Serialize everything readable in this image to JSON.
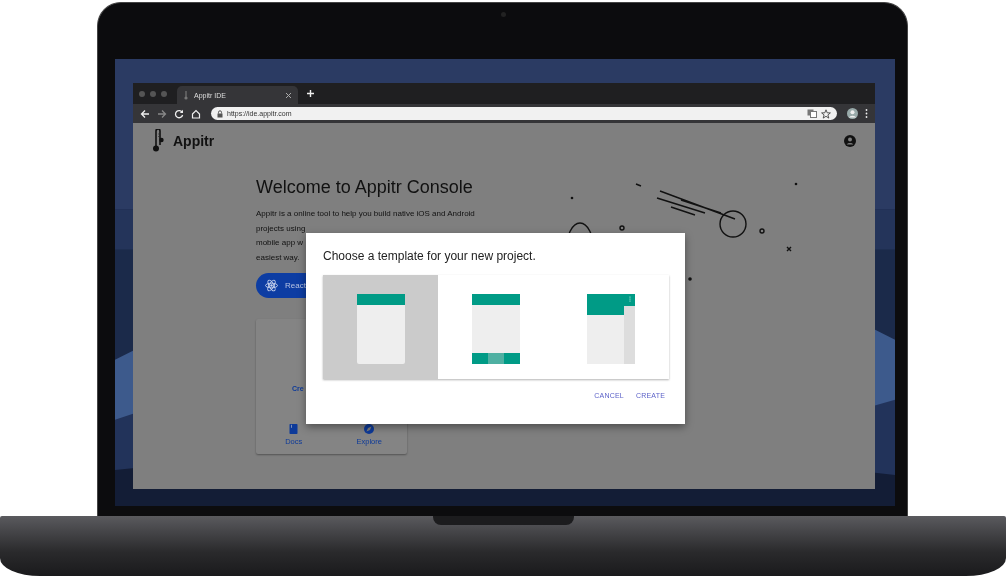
{
  "browser": {
    "tab": {
      "title": "Appitr IDE",
      "selected": true
    },
    "address": "https://ide.appitr.com"
  },
  "app": {
    "name": "Appitr"
  },
  "welcome": {
    "title": "Welcome to Appitr Console",
    "description_lines": [
      "Appitr is a online tool to help you build native iOS and Android",
      "projects using",
      "mobile app w",
      "easiest way."
    ],
    "button": "React"
  },
  "card": {
    "text": "Cre",
    "links": [
      {
        "kind": "docs",
        "label": "Docs"
      },
      {
        "kind": "explore",
        "label": "Explore"
      }
    ]
  },
  "dialog": {
    "title": "Choose a template for your new project.",
    "templates": [
      {
        "kind": "plain",
        "selected": true
      },
      {
        "kind": "bottom-nav",
        "selected": false
      },
      {
        "kind": "drawer",
        "selected": false
      }
    ],
    "actions": [
      "CANCEL",
      "CREATE"
    ]
  }
}
